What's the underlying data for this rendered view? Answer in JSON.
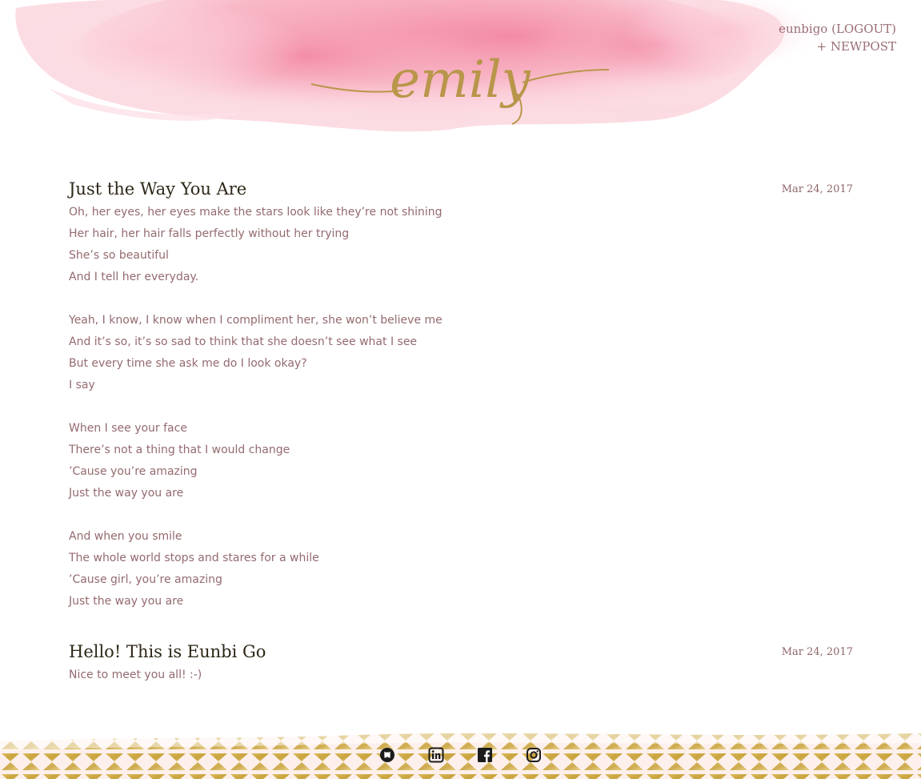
{
  "header": {
    "logo_text": "emily",
    "user": {
      "username": "eunbigo",
      "logout_label": "(LOGOUT)",
      "new_post_label": "+ NEWPOST"
    }
  },
  "posts": [
    {
      "title": "Just the Way You Are",
      "date": "Mar 24, 2017",
      "stanzas": [
        [
          "Oh, her eyes, her eyes make the stars look like they’re not shining",
          "Her hair, her hair falls perfectly without her trying",
          "She’s so beautiful",
          "And I tell her everyday."
        ],
        [
          "Yeah, I know, I know when I compliment her, she won’t believe me",
          "And it’s so, it’s so sad to think that she doesn’t see what I see",
          "But every time she ask me do I look okay?",
          "I say"
        ],
        [
          "When I see your face",
          "There’s not a thing that I would change",
          "’Cause you’re amazing",
          "Just the way you are"
        ],
        [
          "And when you smile",
          "The whole world stops and stares for a while",
          "’Cause girl, you’re amazing",
          "Just the way you are"
        ]
      ]
    },
    {
      "title": "Hello! This is Eunbi Go",
      "date": "Mar 24, 2017",
      "stanzas": [
        [
          "Nice to meet you all! :-)"
        ]
      ]
    }
  ],
  "footer": {
    "social_icons": [
      "github-icon",
      "linkedin-icon",
      "facebook-icon",
      "instagram-icon"
    ]
  },
  "colors": {
    "watercolor_pink": "#f59ab0",
    "gold": "#b8964a",
    "title_text": "#2e2718",
    "body_text": "#946a6f"
  }
}
